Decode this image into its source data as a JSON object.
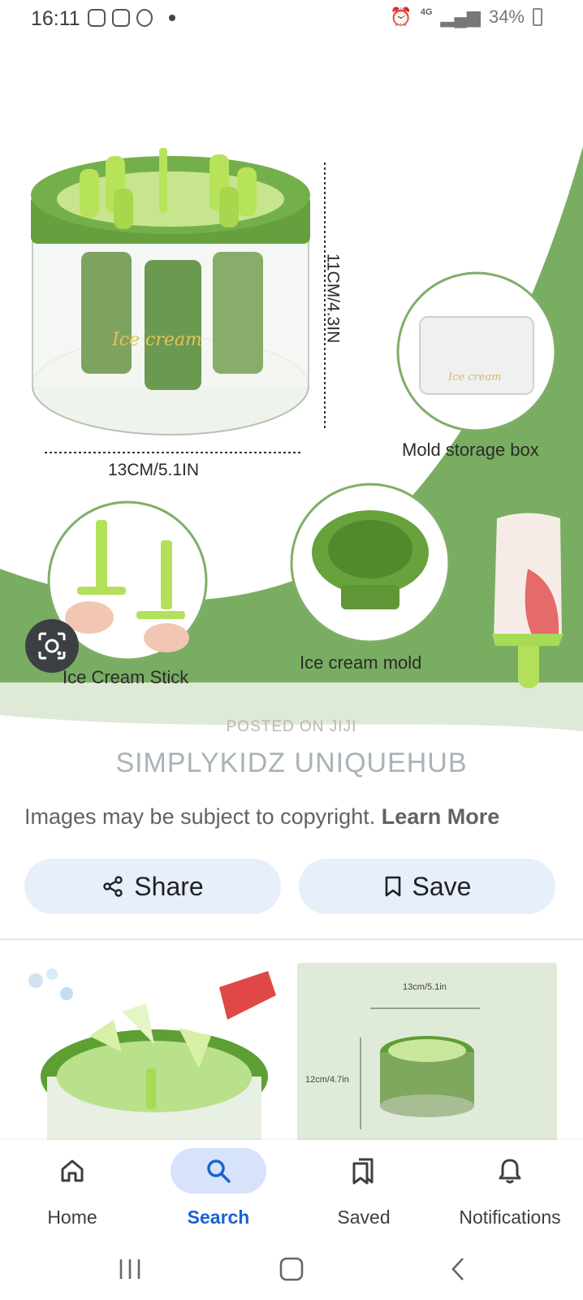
{
  "status_bar": {
    "time": "16:11",
    "network": "4G",
    "battery": "34%"
  },
  "hero": {
    "dimension_height": "11CM/4.3IN",
    "dimension_width": "13CM/5.1IN",
    "product_brand_text": "Ice cream",
    "label_storage_box": "Mold storage box",
    "label_stick": "Ice Cream Stick",
    "label_mold": "Ice cream mold",
    "watermark_small": "POSTED ON JIJI",
    "watermark_large": "SIMPLYKIDZ UNIQUEHUB"
  },
  "copyright": {
    "notice": "Images may be subject to copyright.",
    "link": "Learn More"
  },
  "actions": {
    "share_label": "Share",
    "save_label": "Save"
  },
  "related": {
    "right_dim_width": "13cm/5.1in",
    "right_dim_height": "12cm/4.7in"
  },
  "bottom_nav": {
    "items": [
      {
        "label": "Home",
        "icon": "home-icon"
      },
      {
        "label": "Search",
        "icon": "search-icon",
        "active": true
      },
      {
        "label": "Saved",
        "icon": "saved-icon"
      },
      {
        "label": "Notifications",
        "icon": "bell-icon"
      }
    ]
  },
  "colors": {
    "accent_green": "#6fa752",
    "active_nav_bg": "#d7e3fb",
    "active_nav_text": "#1a62d2",
    "pill_bg": "#e7effb"
  }
}
